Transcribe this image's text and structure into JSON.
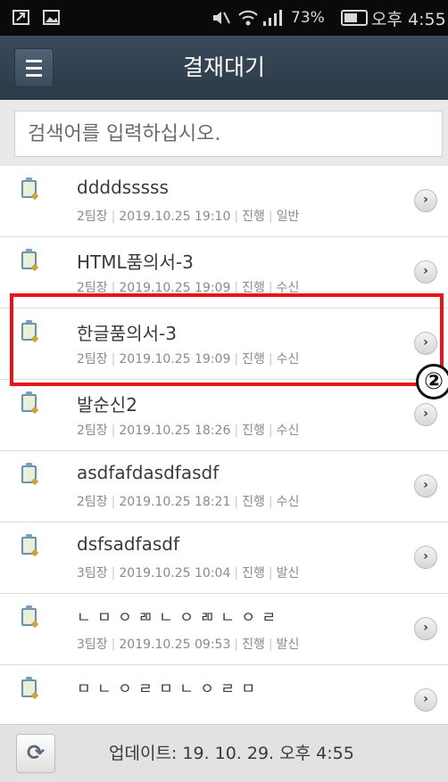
{
  "status_bar": {
    "left_icons": [
      "notification-icon",
      "image-icon"
    ],
    "right_icons": [
      "mute-icon",
      "wifi-icon",
      "signal-icon"
    ],
    "battery": "73%",
    "time": "오후 4:55"
  },
  "header": {
    "title": "결재대기",
    "menu_icon": "hamburger-menu-icon"
  },
  "search": {
    "placeholder": "검색어를 입력하십시오."
  },
  "items": [
    {
      "title": "ddddsssss",
      "author": "2팀장",
      "date": "2019.10.25 19:10",
      "status": "진행",
      "type": "일반"
    },
    {
      "title": "HTML품의서-3",
      "author": "2팀장",
      "date": "2019.10.25 19:09",
      "status": "진행",
      "type": "수신"
    },
    {
      "title": "한글품의서-3",
      "author": "2팀장",
      "date": "2019.10.25 19:09",
      "status": "진행",
      "type": "수신"
    },
    {
      "title": "발순신2",
      "author": "2팀장",
      "date": "2019.10.25 18:26",
      "status": "진행",
      "type": "수신"
    },
    {
      "title": "asdfafdasdfasdf",
      "author": "2팀장",
      "date": "2019.10.25 18:21",
      "status": "진행",
      "type": "수신"
    },
    {
      "title": "dsfsadfasdf",
      "author": "3팀장",
      "date": "2019.10.25 10:04",
      "status": "진행",
      "type": "발신"
    },
    {
      "title": "ㄴ ㅁ ㅇ ㄻ ㄴ ㅇ ㄻ ㄴ ㅇ ㄹ",
      "author": "3팀장",
      "date": "2019.10.25 09:53",
      "status": "진행",
      "type": "발신"
    },
    {
      "title": "ㅁ ㄴ ㅇ ㄹ ㅁ ㄴ ㅇ ㄹ ㅁ",
      "author": "",
      "date": "",
      "status": "",
      "type": ""
    }
  ],
  "annotation": {
    "badge": "②",
    "highlight_color": "#e8141a"
  },
  "footer": {
    "refresh_icon": "refresh-icon",
    "update_text": "업데이트: 19. 10. 29. 오후 4:55"
  },
  "colors": {
    "header_bg": "#2f3e4d",
    "status_bg": "#0a0a0a",
    "footer_bg": "#e2e2e2"
  }
}
